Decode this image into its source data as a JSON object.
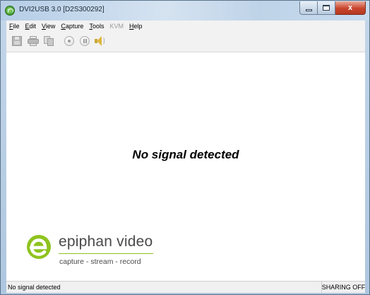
{
  "window": {
    "title": "DVI2USB 3.0 [D2S300292]",
    "icon": "epiphan-app-icon"
  },
  "caption_buttons": {
    "minimize_icon": "minimize-icon",
    "maximize_icon": "maximize-icon",
    "close_label": "x"
  },
  "menu": {
    "items": [
      {
        "label_acc": "F",
        "label_rest": "ile",
        "enabled": true
      },
      {
        "label_acc": "E",
        "label_rest": "dit",
        "enabled": true
      },
      {
        "label_acc": "V",
        "label_rest": "iew",
        "enabled": true
      },
      {
        "label_acc": "C",
        "label_rest": "apture",
        "enabled": true
      },
      {
        "label_acc": "T",
        "label_rest": "ools",
        "enabled": true
      },
      {
        "label": "KVM",
        "enabled": false
      },
      {
        "label_acc": "H",
        "label_rest": "elp",
        "enabled": true
      }
    ]
  },
  "toolbar": {
    "buttons": [
      "save-icon",
      "print-icon",
      "copy-icon",
      "record-icon",
      "pause-icon",
      "speaker-icon"
    ]
  },
  "video": {
    "message": "No signal detected"
  },
  "logo": {
    "name": "epiphan video",
    "tagline": "capture - stream - record",
    "accent_color": "#8fc31f"
  },
  "status": {
    "left": "No signal detected",
    "right": "SHARING OFF"
  }
}
